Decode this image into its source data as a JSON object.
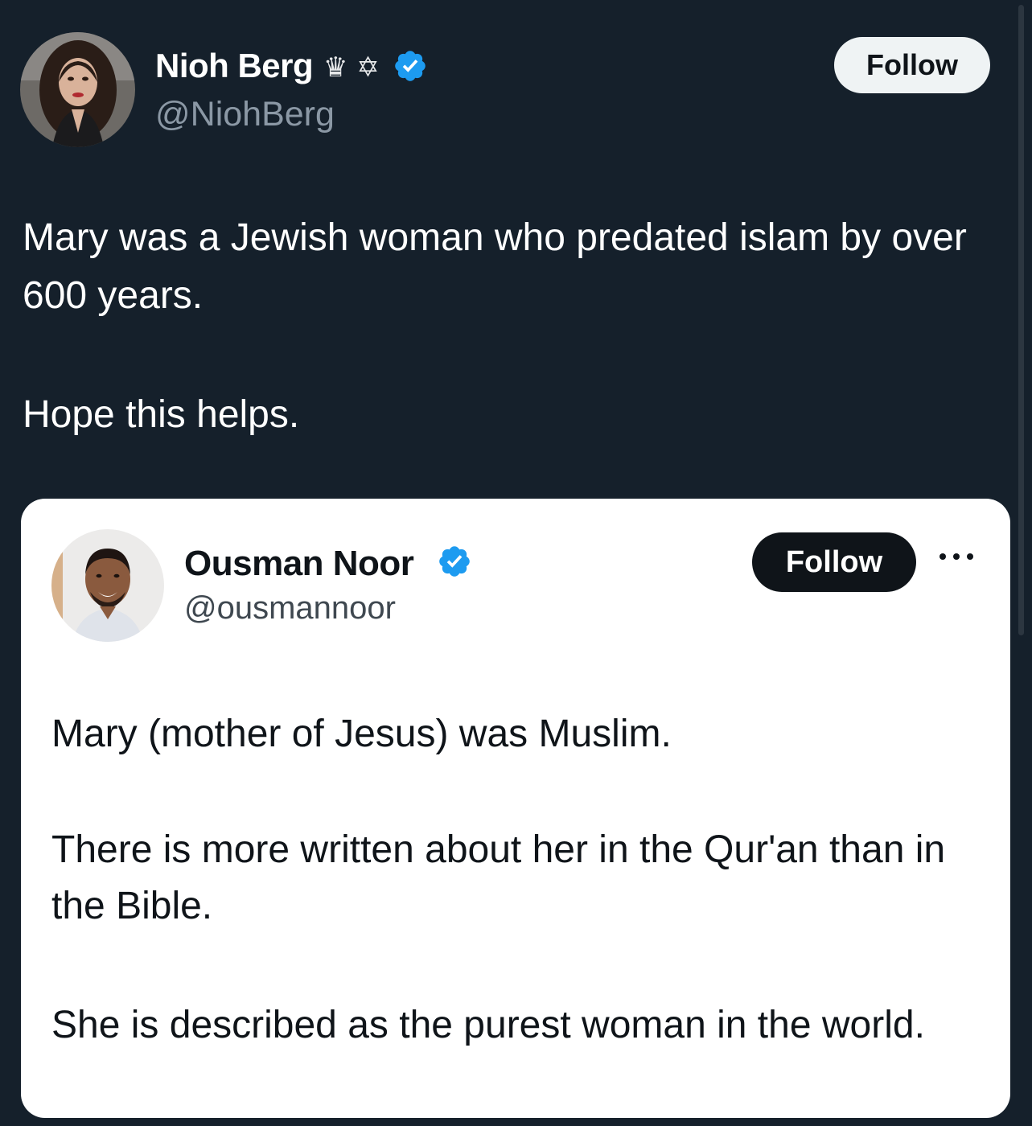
{
  "tweet": {
    "author": {
      "name": "Nioh Berg",
      "emojis": "♛ ✡",
      "handle": "@NiohBerg",
      "verified": true,
      "follow_label": "Follow"
    },
    "text_line_1": "Mary was a Jewish woman who predated islam by over 600 years.",
    "text_line_2": "Hope this helps."
  },
  "quoted": {
    "author": {
      "name": "Ousman Noor",
      "handle": "@ousmannoor",
      "verified": true,
      "follow_label": "Follow"
    },
    "paragraphs": [
      "Mary (mother of Jesus) was Muslim.",
      "There is more written about her in the Qur'an than in the Bible.",
      "She is described as the purest woman in the world."
    ]
  },
  "colors": {
    "background": "#15202b",
    "verified_blue": "#1d9bf0",
    "muted_text": "#8b98a5"
  },
  "icons": [
    "verified-badge-icon",
    "more-options-icon"
  ]
}
